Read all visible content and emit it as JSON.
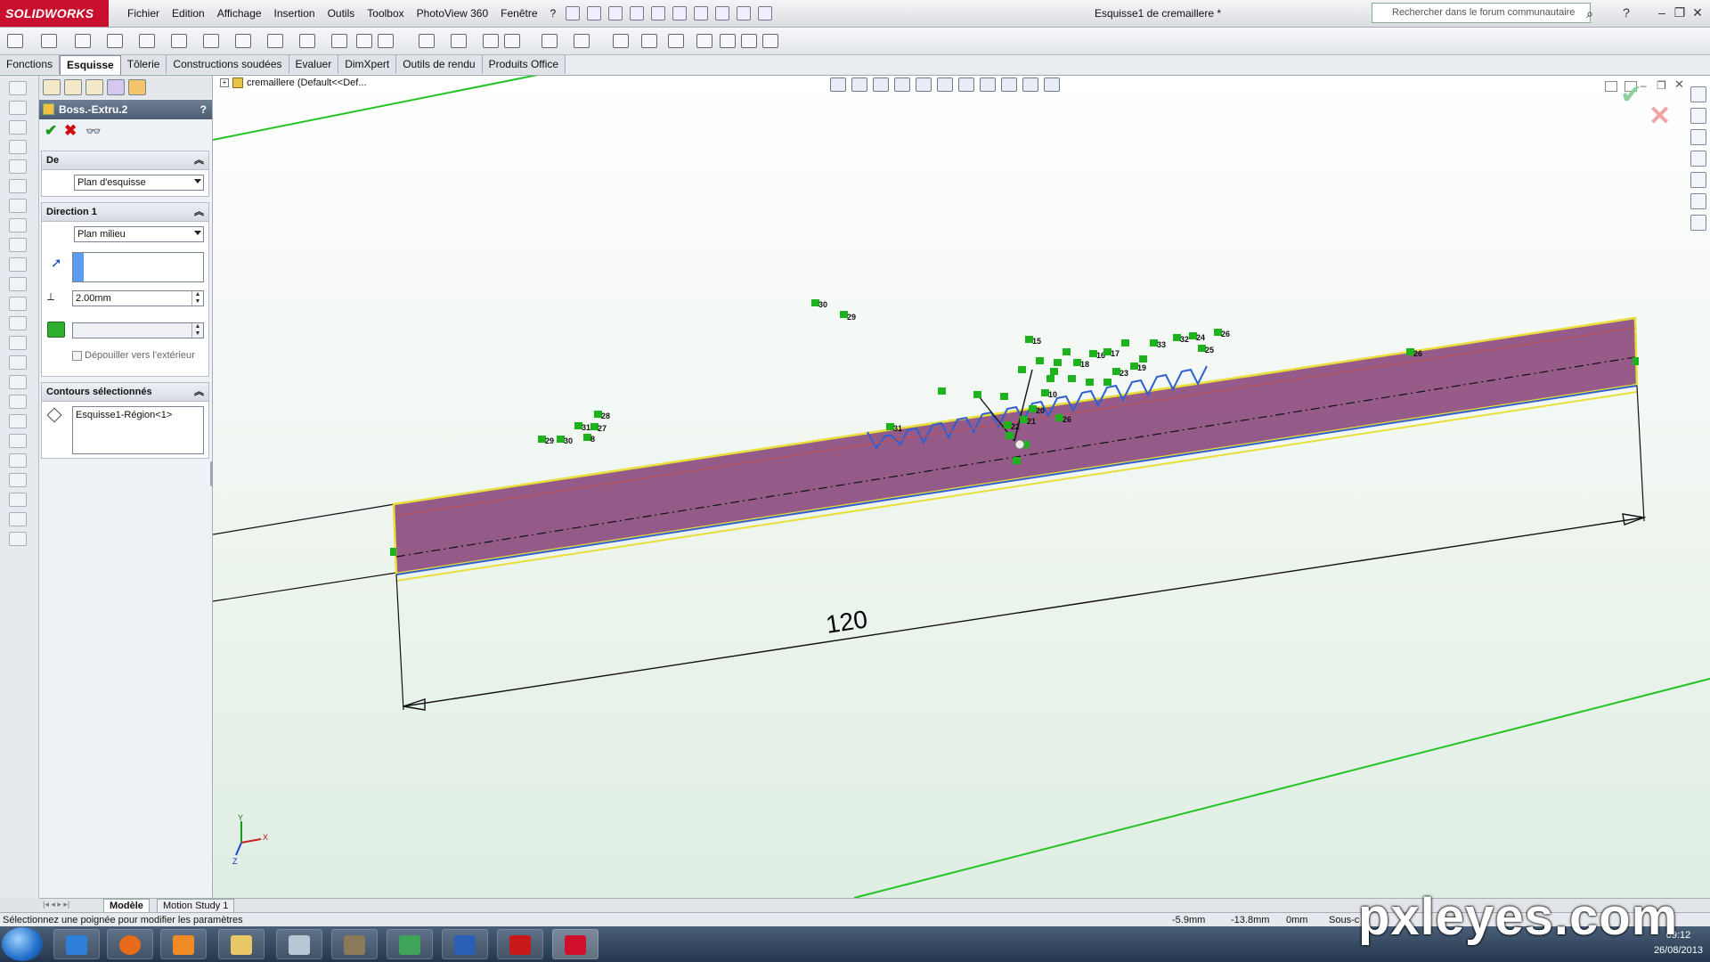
{
  "app": {
    "logo_text": "SOLIDWORKS",
    "window_title": "Esquisse1 de cremaillere *"
  },
  "menu": [
    "Fichier",
    "Edition",
    "Affichage",
    "Insertion",
    "Outils",
    "Toolbox",
    "PhotoView 360",
    "Fenêtre",
    "?"
  ],
  "search": {
    "placeholder": "Rechercher dans le forum communautaire"
  },
  "tabs": [
    "Fonctions",
    "Esquisse",
    "Tôlerie",
    "Constructions soudées",
    "Evaluer",
    "DimXpert",
    "Outils de rendu",
    "Produits Office"
  ],
  "active_tab": "Esquisse",
  "property_manager": {
    "title": "Boss.-Extru.2",
    "help": "?",
    "ok": "✔",
    "cancel": "✖",
    "from": {
      "header": "De",
      "value": "Plan d'esquisse"
    },
    "direction1": {
      "header": "Direction 1",
      "end_condition": "Plan milieu",
      "depth": "2.00mm",
      "draft_label": "Dépouiller vers l'extérieur"
    },
    "contours": {
      "header": "Contours sélectionnés",
      "items": [
        "Esquisse1-Région<1>"
      ]
    }
  },
  "feature_tree": {
    "root": "cremaillere  (Default<<Def..."
  },
  "dimension": {
    "value": "120"
  },
  "relation_labels": [
    "29",
    "30",
    "31",
    "28",
    "27",
    "8",
    "29",
    "30",
    "31",
    "10",
    "20",
    "21",
    "26",
    "22",
    "15",
    "16",
    "17",
    "18",
    "19",
    "23",
    "24",
    "25",
    "26",
    "32",
    "33"
  ],
  "triad": {
    "x": "X",
    "y": "Y",
    "z": "Z"
  },
  "bottom_tabs": [
    "Modèle",
    "Motion Study 1"
  ],
  "status": {
    "message": "Sélectionnez une poignée pour modifier les paramètres",
    "x": "-5.9mm",
    "y": "-13.8mm",
    "z": "0mm",
    "mode": "Sous-c"
  },
  "taskbar": {
    "time": "09:12",
    "date": "26/08/2013",
    "apps": [
      "internet-explorer",
      "firefox",
      "media-player",
      "explorer",
      "calculator",
      "gimp",
      "network-app",
      "word",
      "acrobat",
      "solidworks"
    ]
  },
  "watermark": "pxleyes.com",
  "colors": {
    "brand": "#c8102e",
    "part_fill": "#8e4f80",
    "relation": "#1db31d",
    "edge": "#2f5fd0"
  }
}
